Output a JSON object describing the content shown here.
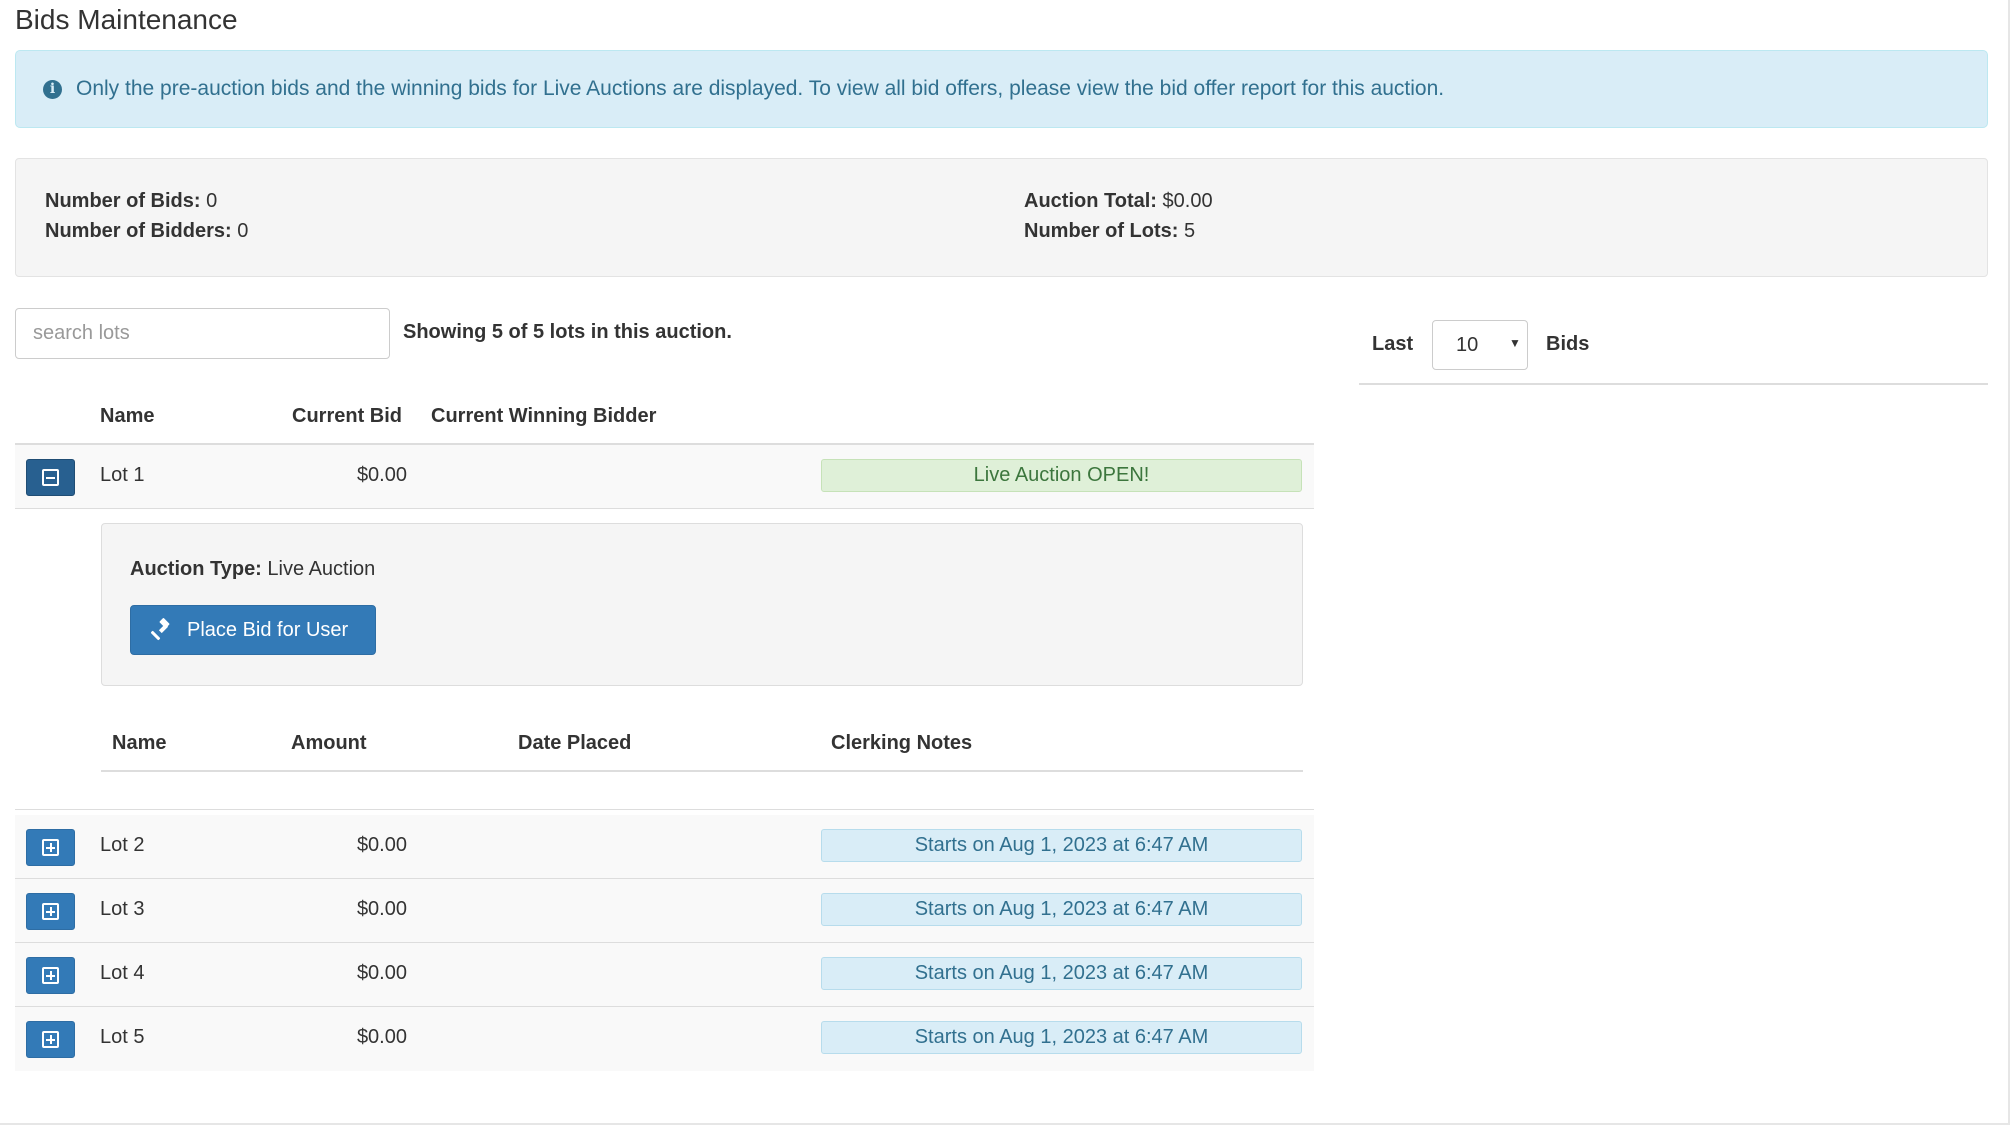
{
  "page": {
    "title": "Bids Maintenance"
  },
  "alert": {
    "text": "Only the pre-auction bids and the winning bids for Live Auctions are displayed. To view all bid offers, please view the bid offer report for this auction."
  },
  "stats": {
    "bids_label": "Number of Bids:",
    "bids_value": "0",
    "bidders_label": "Number of Bidders:",
    "bidders_value": "0",
    "total_label": "Auction Total:",
    "total_value": "$0.00",
    "lots_label": "Number of Lots:",
    "lots_value": "5"
  },
  "search": {
    "placeholder": "search lots",
    "value": ""
  },
  "showing_text": "Showing 5 of 5 lots in this auction.",
  "bids_panel": {
    "last_label": "Last",
    "selected": "10",
    "bids_label": "Bids"
  },
  "lots_table": {
    "headers": {
      "name": "Name",
      "current_bid": "Current Bid",
      "winning_bidder": "Current Winning Bidder"
    },
    "rows": [
      {
        "name": "Lot 1",
        "bid": "$0.00",
        "status": "Live Auction OPEN!"
      },
      {
        "name": "Lot 2",
        "bid": "$0.00",
        "status": "Starts on Aug 1, 2023 at 6:47 AM"
      },
      {
        "name": "Lot 3",
        "bid": "$0.00",
        "status": "Starts on Aug 1, 2023 at 6:47 AM"
      },
      {
        "name": "Lot 4",
        "bid": "$0.00",
        "status": "Starts on Aug 1, 2023 at 6:47 AM"
      },
      {
        "name": "Lot 5",
        "bid": "$0.00",
        "status": "Starts on Aug 1, 2023 at 6:47 AM"
      }
    ]
  },
  "lot_detail": {
    "auction_type_label": "Auction Type:",
    "auction_type_value": "Live Auction",
    "place_bid_label": "Place Bid for User",
    "bids_headers": {
      "name": "Name",
      "amount": "Amount",
      "date_placed": "Date Placed",
      "clerking_notes": "Clerking Notes"
    }
  },
  "icons": {
    "info": "info-circle-icon",
    "collapse": "minus-square-icon",
    "expand": "plus-square-icon",
    "gavel": "gavel-icon",
    "select_caret": "caret-down-icon"
  },
  "colors": {
    "primary": "#337ab7",
    "info_bg": "#d9edf7",
    "info_text": "#31708f",
    "success_bg": "#dff0d8",
    "success_text": "#3c763d"
  }
}
